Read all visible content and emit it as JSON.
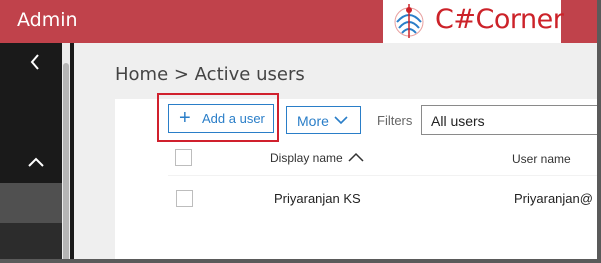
{
  "header": {
    "app_title": "Admin",
    "logo_text": "C#Corner",
    "logo_icon": "c-sharp-corner-logo-icon"
  },
  "sidebar": {
    "collapse_icon": "chevron-left-icon",
    "section_icon": "chevron-up-icon"
  },
  "breadcrumb": {
    "text": "Home > Active users"
  },
  "toolbar": {
    "add_icon": "plus-icon",
    "add_label": "Add a user",
    "more_label": "More",
    "more_icon": "chevron-down-icon",
    "filters_label": "Filters",
    "filter_value": "All users"
  },
  "table": {
    "columns": [
      "Display name",
      "User name"
    ],
    "sort_icon": "sort-ascending-icon",
    "rows": [
      {
        "display_name": "Priyaranjan KS",
        "user_name": "Priyaranjan@"
      }
    ]
  },
  "colors": {
    "brand_red": "#c0424b",
    "accent_blue": "#2a7ec8",
    "highlight_red": "#d0202d",
    "sidebar_dark": "#1a1a1a"
  }
}
